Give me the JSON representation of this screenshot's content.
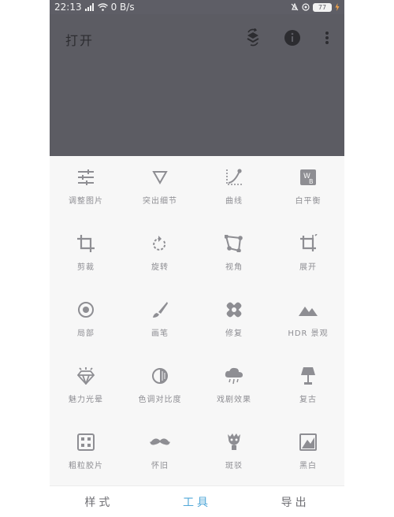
{
  "status_bar": {
    "time": "22:13",
    "network_speed": "0 B/s",
    "battery": "77"
  },
  "header": {
    "open_label": "打开",
    "icons": [
      "layers-refresh-icon",
      "info-icon",
      "more-vert-icon"
    ]
  },
  "tools": [
    {
      "label": "调整图片",
      "icon": "tune-sliders-icon"
    },
    {
      "label": "突出细节",
      "icon": "triangle-down-icon"
    },
    {
      "label": "曲线",
      "icon": "curves-icon"
    },
    {
      "label": "白平衡",
      "icon": "white-balance-icon"
    },
    {
      "label": "剪裁",
      "icon": "crop-icon"
    },
    {
      "label": "旋转",
      "icon": "rotate-icon"
    },
    {
      "label": "视角",
      "icon": "perspective-icon"
    },
    {
      "label": "展开",
      "icon": "expand-icon"
    },
    {
      "label": "局部",
      "icon": "selective-icon"
    },
    {
      "label": "画笔",
      "icon": "brush-icon"
    },
    {
      "label": "修复",
      "icon": "healing-bandage-icon"
    },
    {
      "label": "HDR 景观",
      "icon": "mountain-icon"
    },
    {
      "label": "魅力光晕",
      "icon": "diamond-icon"
    },
    {
      "label": "色调对比度",
      "icon": "tonal-contrast-icon"
    },
    {
      "label": "戏剧效果",
      "icon": "cloud-icon"
    },
    {
      "label": "复古",
      "icon": "lamp-icon"
    },
    {
      "label": "粗粒胶片",
      "icon": "dice-icon"
    },
    {
      "label": "怀旧",
      "icon": "mustache-icon"
    },
    {
      "label": "斑驳",
      "icon": "grunge-icon"
    },
    {
      "label": "黑白",
      "icon": "black-white-icon"
    }
  ],
  "bottom_nav": {
    "styles": "样式",
    "tools": "工具",
    "export": "导出",
    "active": "tools"
  },
  "colors": {
    "status_bar": "#5e5e66",
    "preview": "#5c5c63",
    "icon": "#8e8e93",
    "accent": "#52a8d8"
  }
}
